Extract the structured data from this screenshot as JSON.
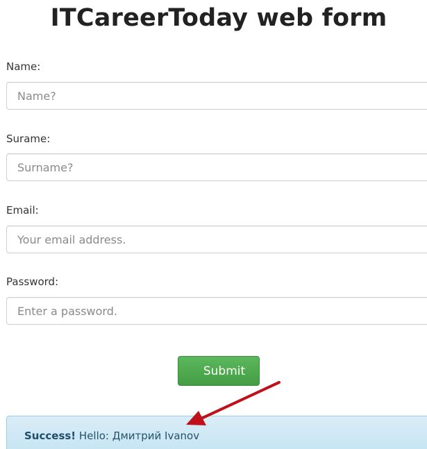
{
  "page": {
    "title": "ITCareerToday web form"
  },
  "form": {
    "fields": [
      {
        "label": "Name:",
        "placeholder": "Name?"
      },
      {
        "label": "Surame:",
        "placeholder": "Surname?"
      },
      {
        "label": "Email:",
        "placeholder": "Your email address."
      },
      {
        "label": "Password:",
        "placeholder": "Enter a password."
      }
    ],
    "submit_label": "Submit"
  },
  "alert": {
    "strong": "Success!",
    "message": " Hello: Дмитрий Ivanov"
  },
  "colors": {
    "button": "#5cb85c",
    "alert_background": "#d9edf7",
    "annotation_arrow": "#c0111a"
  },
  "icons": {
    "annotation": "red-arrow-icon"
  }
}
